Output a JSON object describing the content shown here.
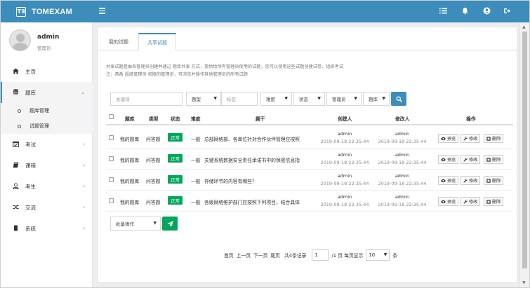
{
  "app": {
    "brand_logo": "T∃",
    "brand_name": "TOMEXAM"
  },
  "user": {
    "name": "admin",
    "role": "管理员"
  },
  "sidebar": {
    "items": [
      {
        "icon": "home-icon",
        "label": "主页"
      },
      {
        "icon": "database-icon",
        "label": "题库",
        "expanded": true
      },
      {
        "icon": "calendar-check-icon",
        "label": "考试"
      },
      {
        "icon": "book-icon",
        "label": "课程"
      },
      {
        "icon": "user-icon",
        "label": "考生"
      },
      {
        "icon": "exchange-icon",
        "label": "交流"
      },
      {
        "icon": "server-icon",
        "label": "系统"
      }
    ],
    "sub_items": [
      "题库管理",
      "试题管理"
    ]
  },
  "tabs": [
    "我的试题",
    "共享试题"
  ],
  "active_tab": "共享试题",
  "notice": {
    "line1": "共享试题是由各管理员创建并通过 题库共享 方式，提供给所有管理员使用的试题，您可以使用这些试题创建试卷、组织考试",
    "line2": "注：具备 超级管理员 权限的管理员，可浏览并操作其他管理员的所有试题"
  },
  "search": {
    "keyword_placeholder": "关键词",
    "type_label": "题型",
    "tag_placeholder": "标签",
    "difficulty_label": "难度",
    "status_label": "状态",
    "admin_label": "管理员",
    "bank_label": "题库"
  },
  "table": {
    "headers": [
      "题库",
      "类型",
      "状态",
      "难度",
      "题干",
      "创建人",
      "修改人",
      "操作"
    ],
    "rows": [
      {
        "bank": "我的题库",
        "type": "问答题",
        "status": "正常",
        "difficulty": "一般",
        "stem": "总部网络部、各单位针对合作伙伴管理应按照",
        "creator": "admin",
        "created": "2019-09-18 22:35:44",
        "modifier": "admin",
        "modified": "2019-09-18 22:35:44"
      },
      {
        "bank": "我的题库",
        "type": "问答题",
        "status": "正常",
        "difficulty": "一般",
        "stem": "关键系统数据安全责任承诺书中的保密信息指",
        "creator": "admin",
        "created": "2019-09-18 22:35:44",
        "modifier": "admin",
        "modified": "2019-09-18 22:35:44"
      },
      {
        "bank": "我的题库",
        "type": "问答题",
        "status": "正常",
        "difficulty": "一般",
        "stem": "存储环节的内容有哪些？",
        "creator": "admin",
        "created": "2019-09-18 22:35:44",
        "modifier": "admin",
        "modified": "2019-09-18 22:35:44"
      },
      {
        "bank": "我的题库",
        "type": "问答题",
        "status": "正常",
        "difficulty": "一般",
        "stem": "各级网络维护部门应按照下列项目，结合具体",
        "creator": "admin",
        "created": "2019-09-18 22:35:44",
        "modifier": "admin",
        "modified": "2019-09-18 22:35:44"
      }
    ],
    "actions": {
      "preview": "预览",
      "edit": "修改",
      "delete": "删除"
    }
  },
  "batch": {
    "label": "批量操作"
  },
  "pager": {
    "first": "首页",
    "prev": "上一页",
    "next": "下一页",
    "last": "尾页",
    "total": "共4条记录",
    "page_value": "1",
    "page_suffix": "/1 页 每页显示",
    "page_size": "10",
    "size_suffix": "条"
  },
  "colors": {
    "primary": "#3c8dbc",
    "success": "#00a65a"
  }
}
